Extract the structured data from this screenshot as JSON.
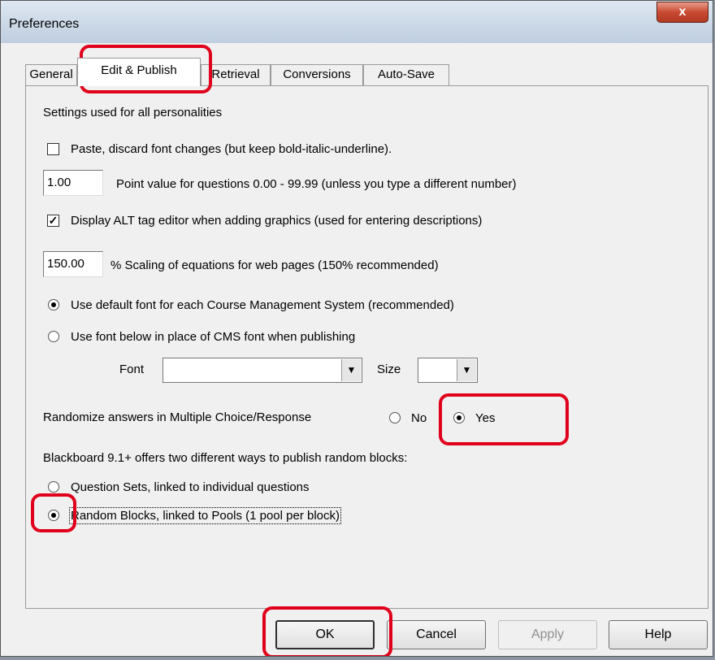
{
  "window": {
    "title": "Preferences",
    "close_glyph": "x"
  },
  "tabs": [
    {
      "label": "General",
      "active": false
    },
    {
      "label": "Edit & Publish",
      "active": true
    },
    {
      "label": "Retrieval",
      "active": false
    },
    {
      "label": "Conversions",
      "active": false
    },
    {
      "label": "Auto-Save",
      "active": false
    }
  ],
  "panel": {
    "section_heading": "Settings used for all personalities",
    "paste_discard": {
      "label": "Paste, discard font changes (but keep bold-italic-underline).",
      "checked": false
    },
    "point_value": {
      "value": "1.00",
      "label": "Point value for questions 0.00 - 99.99  (unless you type a different number)"
    },
    "alt_tag": {
      "label": "Display ALT tag editor when adding graphics (used for entering descriptions)",
      "checked": true,
      "check_glyph": "✓"
    },
    "scaling": {
      "value": "150.00",
      "label": "%  Scaling of equations for web pages (150% recommended)"
    },
    "font_choice": {
      "default_label": "Use default font for each Course Management System (recommended)",
      "custom_label": "Use font below in place of CMS font when publishing",
      "selected": "default"
    },
    "font_label": "Font",
    "font_value": "",
    "size_label": "Size",
    "size_value": "",
    "randomize": {
      "label": "Randomize answers in Multiple Choice/Response",
      "no_label": "No",
      "yes_label": "Yes",
      "selected": "Yes"
    },
    "blackboard": {
      "heading": "Blackboard 9.1+ offers two different ways to publish random blocks:",
      "question_sets_label": "Question Sets, linked to individual questions",
      "random_blocks_label": "Random Blocks, linked to Pools (1 pool per block)",
      "selected": "random_blocks"
    }
  },
  "buttons": {
    "ok": "OK",
    "cancel": "Cancel",
    "apply": "Apply",
    "help": "Help"
  },
  "colors": {
    "highlight": "#e0001b",
    "title_bar": "#c9d7e6",
    "close_button": "#c94a32"
  }
}
